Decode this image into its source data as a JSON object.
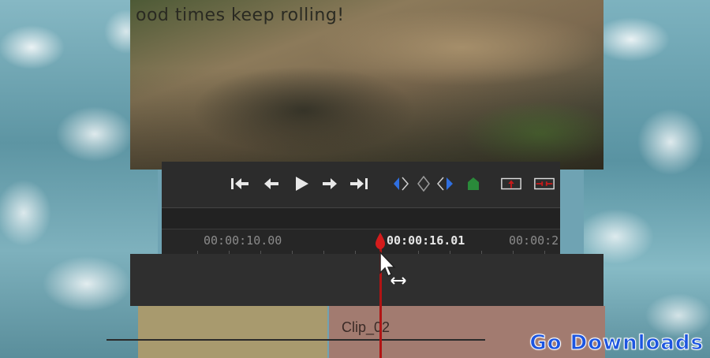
{
  "video": {
    "overlay_text": "ood times keep rolling!"
  },
  "transport": {
    "buttons": [
      {
        "name": "go-to-start",
        "glyph": "⇤"
      },
      {
        "name": "step-back",
        "glyph": "←"
      },
      {
        "name": "play",
        "glyph": "▶"
      },
      {
        "name": "step-forward",
        "glyph": "→"
      },
      {
        "name": "go-to-end",
        "glyph": "⇥"
      }
    ]
  },
  "timeline": {
    "timecodes": [
      "00:00:10.00",
      "00:00:16.01",
      "00:00:2"
    ],
    "clip_label": "Clip_02"
  },
  "watermark": {
    "text": "Go Downloads"
  },
  "colors": {
    "playhead": "#b11414",
    "accent_blue": "#2f6fe0",
    "accent_green": "#2a8a3a",
    "accent_red": "#c81a1a"
  }
}
